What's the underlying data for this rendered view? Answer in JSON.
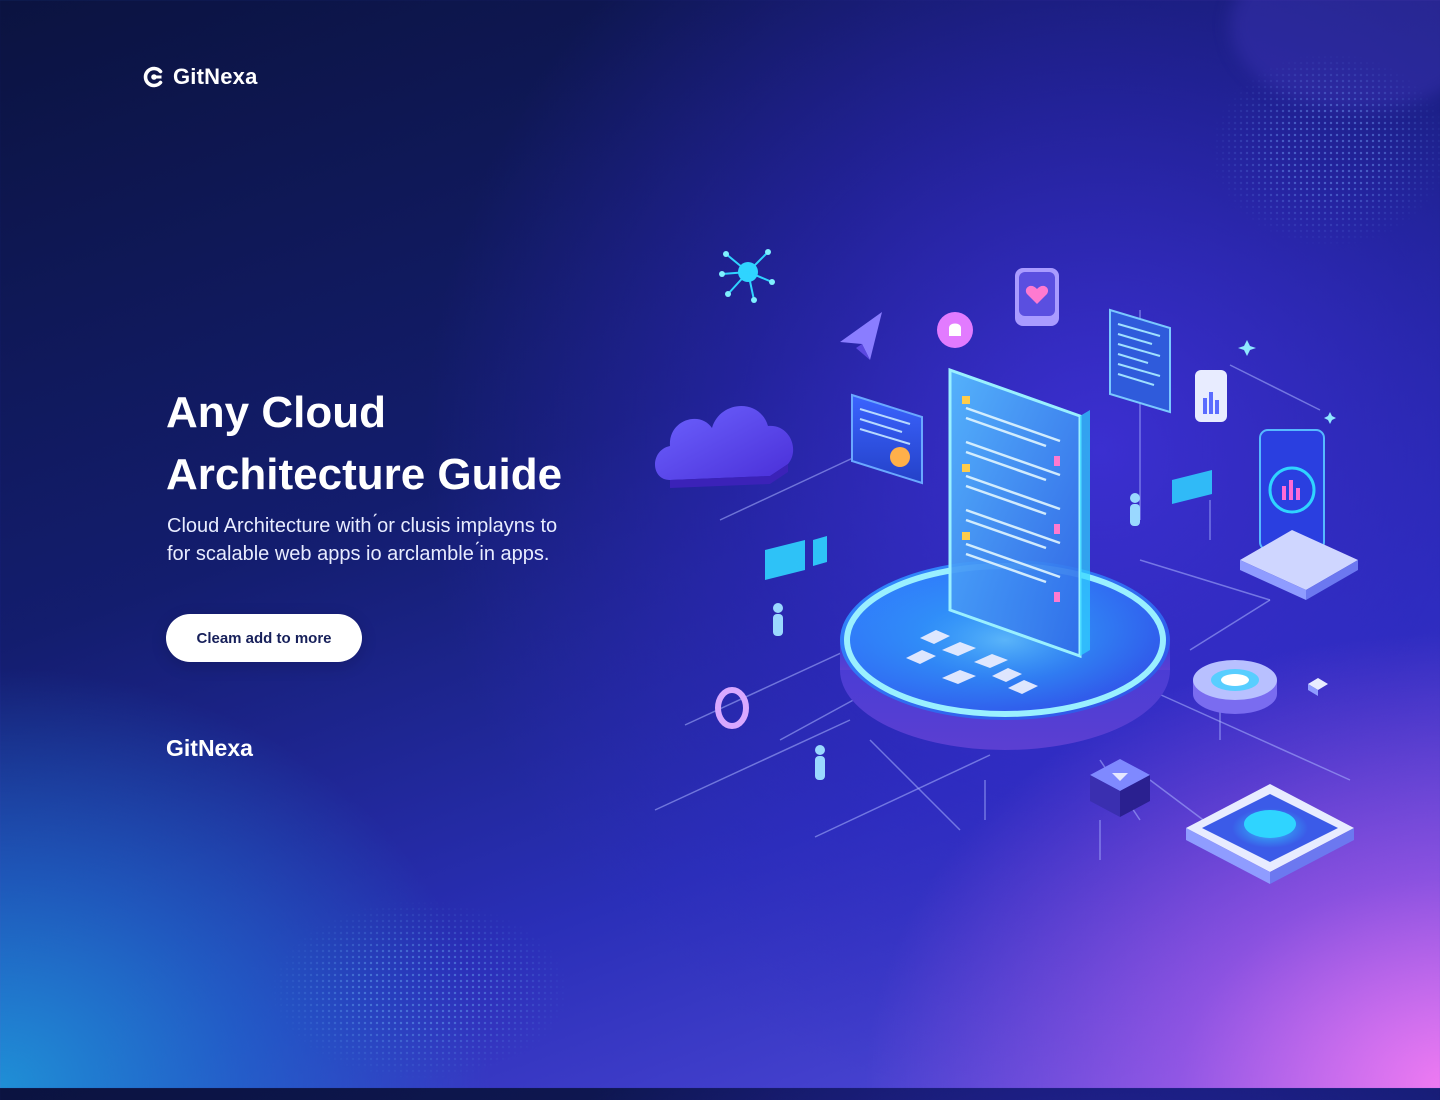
{
  "brand": {
    "name": "GitNexa",
    "logo_icon": "gitnexa-logo-icon"
  },
  "hero": {
    "title_line1": "Any Cloud",
    "title_line2": "Architecture Guide",
    "subtitle_line1": "Cloud Architecture with ́or clusis implayns to",
    "subtitle_line2": "for scalable web apps io arclamble ́in apps.",
    "cta_label": "Cleam add to more"
  },
  "footer": {
    "brand": "GitNexa"
  },
  "illustration": {
    "icons": [
      "cloud-icon",
      "network-icon",
      "send-icon",
      "bell-icon",
      "heart-icon",
      "document-icon",
      "chart-icon",
      "server-icon",
      "database-icon",
      "person-icon"
    ]
  },
  "colors": {
    "bg_top": "#0b1340",
    "bg_mid": "#2a2fb8",
    "accent_pink": "#f07bf2",
    "accent_cyan": "#2fd4ff",
    "cta_bg": "#ffffff",
    "cta_text": "#17205a"
  }
}
